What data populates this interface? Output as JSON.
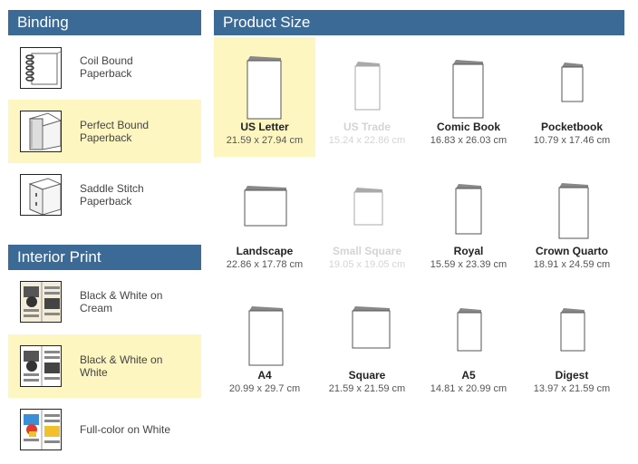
{
  "binding": {
    "title": "Binding",
    "options": [
      {
        "line1": "Coil Bound",
        "line2": "Paperback",
        "icon": "coil-bound-icon",
        "selected": false
      },
      {
        "line1": "Perfect Bound",
        "line2": "Paperback",
        "icon": "perfect-bound-icon",
        "selected": true
      },
      {
        "line1": "Saddle Stitch",
        "line2": "Paperback",
        "icon": "saddle-stitch-icon",
        "selected": false
      }
    ]
  },
  "interior": {
    "title": "Interior Print",
    "options": [
      {
        "line1": "Black & White on",
        "line2": "Cream",
        "icon": "bw-cream-icon",
        "selected": false
      },
      {
        "line1": "Black & White on",
        "line2": "White",
        "icon": "bw-white-icon",
        "selected": true
      },
      {
        "line1": "Full-color on White",
        "line2": "",
        "icon": "full-color-icon",
        "selected": false
      }
    ]
  },
  "product_size": {
    "title": "Product Size",
    "sizes": [
      {
        "name": "US Letter",
        "dims": "21.59 x 27.94 cm",
        "selected": true,
        "disabled": false
      },
      {
        "name": "US Trade",
        "dims": "15.24 x 22.86 cm",
        "selected": false,
        "disabled": true
      },
      {
        "name": "Comic Book",
        "dims": "16.83 x 26.03 cm",
        "selected": false,
        "disabled": false
      },
      {
        "name": "Pocketbook",
        "dims": "10.79 x 17.46 cm",
        "selected": false,
        "disabled": false
      },
      {
        "name": "Landscape",
        "dims": "22.86 x 17.78 cm",
        "selected": false,
        "disabled": false
      },
      {
        "name": "Small Square",
        "dims": "19.05 x 19.05 cm",
        "selected": false,
        "disabled": true
      },
      {
        "name": "Royal",
        "dims": "15.59 x 23.39 cm",
        "selected": false,
        "disabled": false
      },
      {
        "name": "Crown Quarto",
        "dims": "18.91 x 24.59 cm",
        "selected": false,
        "disabled": false
      },
      {
        "name": "A4",
        "dims": "20.99 x 29.7 cm",
        "selected": false,
        "disabled": false
      },
      {
        "name": "Square",
        "dims": "21.59 x 21.59 cm",
        "selected": false,
        "disabled": false
      },
      {
        "name": "A5",
        "dims": "14.81 x 20.99 cm",
        "selected": false,
        "disabled": false
      },
      {
        "name": "Digest",
        "dims": "13.97 x 21.59 cm",
        "selected": false,
        "disabled": false
      }
    ]
  },
  "colors": {
    "header": "#3b6a97",
    "selected": "#fdf6c0",
    "cover": "#888888",
    "disabled_text": "#d4d4d4"
  }
}
